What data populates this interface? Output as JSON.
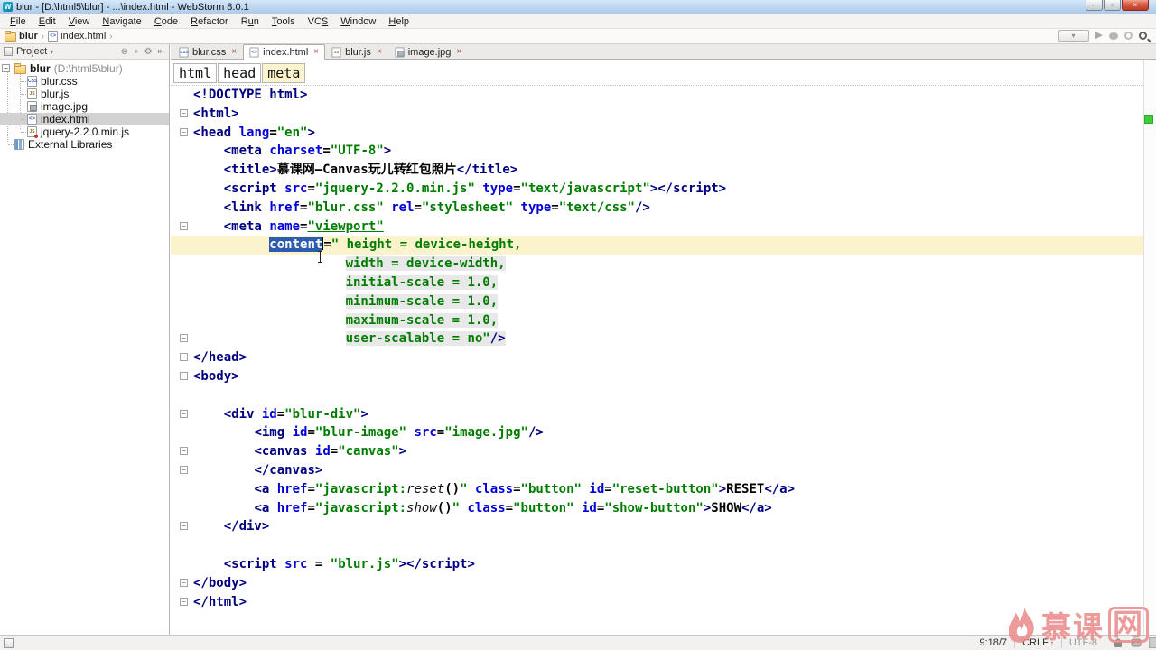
{
  "window": {
    "title": "blur - [D:\\html5\\blur] - ...\\index.html - WebStorm 8.0.1",
    "app_badge": "W"
  },
  "icons": {
    "minimize": "–",
    "restore": "▫",
    "close_window": "×",
    "close": "×",
    "expander": "−",
    "fold_minus": "−",
    "crumb_sep": "›",
    "combo_caret": "▾",
    "header_caret": "▾",
    "play": "▶",
    "updown": "↕",
    "filetext": {
      "css": "CSS",
      "js": "JS",
      "jsmin": "JS",
      "html": "<>",
      "img": "",
      "folder": "",
      "lib": ""
    },
    "project_header_tools": [
      {
        "glyph": "⊗",
        "name": "close-circle-icon"
      },
      {
        "glyph": "⌖",
        "name": "scroll-from-source-icon"
      },
      {
        "glyph": "⚙",
        "name": "gear-icon"
      },
      {
        "glyph": "⇤",
        "name": "hide-panel-icon"
      }
    ]
  },
  "menubar": {
    "items": [
      {
        "label": "File",
        "u": 0
      },
      {
        "label": "Edit",
        "u": 0
      },
      {
        "label": "View",
        "u": 0
      },
      {
        "label": "Navigate",
        "u": 0
      },
      {
        "label": "Code",
        "u": 0
      },
      {
        "label": "Refactor",
        "u": 0
      },
      {
        "label": "Run",
        "u": 1
      },
      {
        "label": "Tools",
        "u": 0
      },
      {
        "label": "VCS",
        "u": 2
      },
      {
        "label": "Window",
        "u": 0
      },
      {
        "label": "Help",
        "u": 0
      }
    ]
  },
  "navbar": {
    "crumbs": [
      {
        "label": "blur",
        "icon": "folder",
        "bold": true
      },
      {
        "label": "index.html",
        "icon": "html",
        "bold": false
      }
    ]
  },
  "project": {
    "header": {
      "title": "Project"
    },
    "tree": [
      {
        "label": "blur",
        "detail": "(D:\\html5\\blur)",
        "icon": "folder",
        "level": 0,
        "expander": true,
        "bold": true
      },
      {
        "label": "blur.css",
        "icon": "css",
        "level": 1,
        "stub": true
      },
      {
        "label": "blur.js",
        "icon": "js",
        "level": 1,
        "stub": true
      },
      {
        "label": "image.jpg",
        "icon": "img",
        "level": 1,
        "stub": true
      },
      {
        "label": "index.html",
        "icon": "html",
        "level": 1,
        "stub": true,
        "selected": true
      },
      {
        "label": "jquery-2.2.0.min.js",
        "icon": "jsmin",
        "level": 1,
        "stub": true
      },
      {
        "label": "External Libraries",
        "icon": "lib",
        "level": 0,
        "stub": true
      }
    ]
  },
  "tabs": [
    {
      "label": "blur.css",
      "icon": "css",
      "active": false
    },
    {
      "label": "index.html",
      "icon": "html",
      "active": true
    },
    {
      "label": "blur.js",
      "icon": "js",
      "active": false
    },
    {
      "label": "image.jpg",
      "icon": "img",
      "active": false
    }
  ],
  "editor": {
    "breadcrumbs": [
      "html",
      "head",
      "meta"
    ],
    "lines": [
      {
        "seg": [
          [
            "tag",
            "<!DOCTYPE html>"
          ]
        ]
      },
      {
        "f": "s",
        "seg": [
          [
            "tag",
            "<html>"
          ]
        ]
      },
      {
        "f": "s",
        "seg": [
          [
            "tag",
            "<head"
          ],
          [
            "plain",
            " "
          ],
          [
            "attr",
            "lang"
          ],
          [
            "plain",
            "="
          ],
          [
            "val",
            "\"en\""
          ],
          [
            "tag",
            ">"
          ]
        ]
      },
      {
        "seg": [
          [
            "plain",
            "    "
          ],
          [
            "tag",
            "<meta"
          ],
          [
            "plain",
            " "
          ],
          [
            "attr",
            "charset"
          ],
          [
            "plain",
            "="
          ],
          [
            "val",
            "\"UTF-8\""
          ],
          [
            "tag",
            ">"
          ]
        ]
      },
      {
        "seg": [
          [
            "plain",
            "    "
          ],
          [
            "tag",
            "<title>"
          ],
          [
            "txt",
            "慕课网—Canvas玩儿转红包照片"
          ],
          [
            "tag",
            "</title>"
          ]
        ]
      },
      {
        "seg": [
          [
            "plain",
            "    "
          ],
          [
            "tag",
            "<script"
          ],
          [
            "plain",
            " "
          ],
          [
            "attr",
            "src"
          ],
          [
            "plain",
            "="
          ],
          [
            "val",
            "\"jquery-2.2.0.min.js\""
          ],
          [
            "plain",
            " "
          ],
          [
            "attr",
            "type"
          ],
          [
            "plain",
            "="
          ],
          [
            "val",
            "\"text/javascript\""
          ],
          [
            "tag",
            "></script>"
          ]
        ]
      },
      {
        "seg": [
          [
            "plain",
            "    "
          ],
          [
            "tag",
            "<link"
          ],
          [
            "plain",
            " "
          ],
          [
            "attr",
            "href"
          ],
          [
            "plain",
            "="
          ],
          [
            "val",
            "\"blur.css\""
          ],
          [
            "plain",
            " "
          ],
          [
            "attr",
            "rel"
          ],
          [
            "plain",
            "="
          ],
          [
            "val",
            "\"stylesheet\""
          ],
          [
            "plain",
            " "
          ],
          [
            "attr",
            "type"
          ],
          [
            "plain",
            "="
          ],
          [
            "val",
            "\"text/css\""
          ],
          [
            "tag",
            "/>"
          ]
        ]
      },
      {
        "f": "s",
        "seg": [
          [
            "plain",
            "    "
          ],
          [
            "tag",
            "<meta"
          ],
          [
            "plain",
            " "
          ],
          [
            "attr",
            "name"
          ],
          [
            "plain",
            "="
          ],
          [
            "val u",
            "\"viewport\""
          ]
        ]
      },
      {
        "cur": true,
        "seg": [
          [
            "plain",
            "          "
          ],
          [
            "sel",
            "content"
          ],
          [
            "plain",
            "="
          ],
          [
            "val",
            "\" height = device-height,"
          ]
        ]
      },
      {
        "seg": [
          [
            "plain",
            "                    "
          ],
          [
            "val g",
            "width = device-width,"
          ]
        ]
      },
      {
        "seg": [
          [
            "plain",
            "                    "
          ],
          [
            "val g",
            "initial-scale = 1.0,"
          ]
        ]
      },
      {
        "seg": [
          [
            "plain",
            "                    "
          ],
          [
            "val g",
            "minimum-scale = 1.0,"
          ]
        ]
      },
      {
        "seg": [
          [
            "plain",
            "                    "
          ],
          [
            "val g",
            "maximum-scale = 1.0,"
          ]
        ]
      },
      {
        "f": "e",
        "seg": [
          [
            "plain",
            "                    "
          ],
          [
            "val g",
            "user-scalable = no\""
          ],
          [
            "tag g",
            "/>"
          ]
        ]
      },
      {
        "f": "e",
        "seg": [
          [
            "tag",
            "</head>"
          ]
        ]
      },
      {
        "f": "s",
        "seg": [
          [
            "tag",
            "<body>"
          ]
        ]
      },
      {
        "seg": []
      },
      {
        "f": "s",
        "seg": [
          [
            "plain",
            "    "
          ],
          [
            "tag",
            "<div"
          ],
          [
            "plain",
            " "
          ],
          [
            "attr",
            "id"
          ],
          [
            "plain",
            "="
          ],
          [
            "val",
            "\"blur-div\""
          ],
          [
            "tag",
            ">"
          ]
        ]
      },
      {
        "seg": [
          [
            "plain",
            "        "
          ],
          [
            "tag",
            "<img"
          ],
          [
            "plain",
            " "
          ],
          [
            "attr",
            "id"
          ],
          [
            "plain",
            "="
          ],
          [
            "val",
            "\"blur-image\""
          ],
          [
            "plain",
            " "
          ],
          [
            "attr",
            "src"
          ],
          [
            "plain",
            "="
          ],
          [
            "val",
            "\"image.jpg\""
          ],
          [
            "tag",
            "/>"
          ]
        ]
      },
      {
        "f": "s",
        "seg": [
          [
            "plain",
            "        "
          ],
          [
            "tag",
            "<canvas"
          ],
          [
            "plain",
            " "
          ],
          [
            "attr",
            "id"
          ],
          [
            "plain",
            "="
          ],
          [
            "val",
            "\"canvas\""
          ],
          [
            "tag",
            ">"
          ]
        ]
      },
      {
        "f": "e",
        "seg": [
          [
            "plain",
            "        "
          ],
          [
            "tag",
            "</canvas>"
          ]
        ]
      },
      {
        "seg": [
          [
            "plain",
            "        "
          ],
          [
            "tag",
            "<a"
          ],
          [
            "plain",
            " "
          ],
          [
            "attr",
            "href"
          ],
          [
            "plain",
            "="
          ],
          [
            "val",
            "\"javascript:"
          ],
          [
            "js",
            "reset"
          ],
          [
            "plain",
            "()"
          ],
          [
            "val",
            "\""
          ],
          [
            "plain",
            " "
          ],
          [
            "attr",
            "class"
          ],
          [
            "plain",
            "="
          ],
          [
            "val",
            "\"button\""
          ],
          [
            "plain",
            " "
          ],
          [
            "attr",
            "id"
          ],
          [
            "plain",
            "="
          ],
          [
            "val",
            "\"reset-button\""
          ],
          [
            "tag",
            ">"
          ],
          [
            "txt",
            "RESET"
          ],
          [
            "tag",
            "</a>"
          ]
        ]
      },
      {
        "seg": [
          [
            "plain",
            "        "
          ],
          [
            "tag",
            "<a"
          ],
          [
            "plain",
            " "
          ],
          [
            "attr",
            "href"
          ],
          [
            "plain",
            "="
          ],
          [
            "val",
            "\"javascript:"
          ],
          [
            "js",
            "show"
          ],
          [
            "plain",
            "()"
          ],
          [
            "val",
            "\""
          ],
          [
            "plain",
            " "
          ],
          [
            "attr",
            "class"
          ],
          [
            "plain",
            "="
          ],
          [
            "val",
            "\"button\""
          ],
          [
            "plain",
            " "
          ],
          [
            "attr",
            "id"
          ],
          [
            "plain",
            "="
          ],
          [
            "val",
            "\"show-button\""
          ],
          [
            "tag",
            ">"
          ],
          [
            "txt",
            "SHOW"
          ],
          [
            "tag",
            "</a>"
          ]
        ]
      },
      {
        "f": "e",
        "seg": [
          [
            "plain",
            "    "
          ],
          [
            "tag",
            "</div>"
          ]
        ]
      },
      {
        "seg": []
      },
      {
        "seg": [
          [
            "plain",
            "    "
          ],
          [
            "tag",
            "<script"
          ],
          [
            "plain",
            " "
          ],
          [
            "attr",
            "src"
          ],
          [
            "plain",
            " = "
          ],
          [
            "val",
            "\"blur.js\""
          ],
          [
            "tag",
            "></script>"
          ]
        ]
      },
      {
        "f": "e",
        "seg": [
          [
            "tag",
            "</body>"
          ]
        ]
      },
      {
        "f": "e",
        "seg": [
          [
            "tag",
            "</html>"
          ]
        ]
      }
    ]
  },
  "statusbar": {
    "position": "9:18/7",
    "line_sep": "CRLF",
    "encoding": "UTF-8"
  },
  "watermark": {
    "text_pre": "慕课",
    "text_boxed": "网"
  }
}
